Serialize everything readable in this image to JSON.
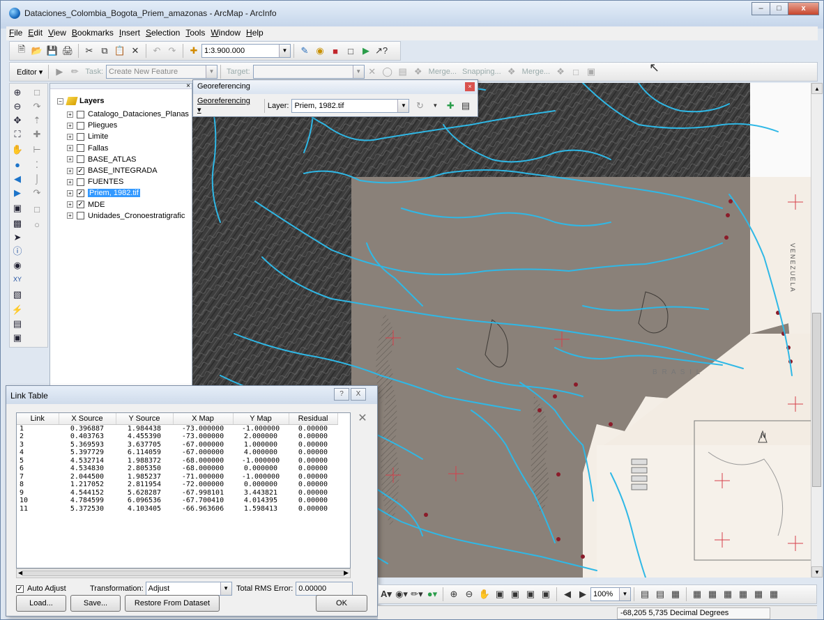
{
  "window": {
    "title": "Dataciones_Colombia_Bogota_Priem_amazonas - ArcMap - ArcInfo",
    "minimize": "–",
    "maximize": "□",
    "close": "x"
  },
  "menu": [
    "File",
    "Edit",
    "View",
    "Bookmarks",
    "Insert",
    "Selection",
    "Tools",
    "Window",
    "Help"
  ],
  "standard_toolbar": {
    "scale": "1:3.900.000"
  },
  "editor_toolbar": {
    "editor_label": "Editor ▾",
    "task_label": "Task:",
    "task_value": "Create New Feature",
    "target_label": "Target:",
    "target_value": "",
    "merge1": "Merge...",
    "snapping": "Snapping...",
    "merge2": "Merge..."
  },
  "toc": {
    "root_label": "Layers",
    "layers": [
      {
        "name": "Catalogo_Dataciones_Planas",
        "checked": false,
        "selected": false
      },
      {
        "name": "Pliegues",
        "checked": false,
        "selected": false
      },
      {
        "name": "Limite",
        "checked": false,
        "selected": false
      },
      {
        "name": "Fallas",
        "checked": false,
        "selected": false
      },
      {
        "name": "BASE_ATLAS",
        "checked": false,
        "selected": false
      },
      {
        "name": "BASE_INTEGRADA",
        "checked": true,
        "selected": false
      },
      {
        "name": "FUENTES",
        "checked": false,
        "selected": false
      },
      {
        "name": "Priem, 1982.tif",
        "checked": true,
        "selected": true
      },
      {
        "name": "MDE",
        "checked": true,
        "selected": false
      },
      {
        "name": "Unidades_Cronoestratigrafic",
        "checked": false,
        "selected": false
      }
    ]
  },
  "georef": {
    "title": "Georeferencing",
    "menu_label": "Georeferencing ▾",
    "layer_label": "Layer:",
    "layer_value": "Priem, 1982.tif"
  },
  "link_table": {
    "title": "Link Table",
    "help_btn": "?",
    "close_btn": "X",
    "columns": [
      "Link",
      "X Source",
      "Y Source",
      "X Map",
      "Y Map",
      "Residual"
    ],
    "rows": [
      [
        "1",
        "0.396887",
        "1.984438",
        "-73.000000",
        "-1.000000",
        "0.00000"
      ],
      [
        "2",
        "0.403763",
        "4.455390",
        "-73.000000",
        "2.000000",
        "0.00000"
      ],
      [
        "3",
        "5.369593",
        "3.637705",
        "-67.000000",
        "1.000000",
        "0.00000"
      ],
      [
        "4",
        "5.397729",
        "6.114059",
        "-67.000000",
        "4.000000",
        "0.00000"
      ],
      [
        "5",
        "4.532714",
        "1.988372",
        "-68.000000",
        "-1.000000",
        "0.00000"
      ],
      [
        "6",
        "4.534830",
        "2.805350",
        "-68.000000",
        "0.000000",
        "0.00000"
      ],
      [
        "7",
        "2.044500",
        "1.985237",
        "-71.000000",
        "-1.000000",
        "0.00000"
      ],
      [
        "8",
        "1.217052",
        "2.811954",
        "-72.000000",
        "0.000000",
        "0.00000"
      ],
      [
        "9",
        "4.544152",
        "5.628287",
        "-67.998101",
        "3.443821",
        "0.00000"
      ],
      [
        "10",
        "4.784599",
        "6.096536",
        "-67.700410",
        "4.014395",
        "0.00000"
      ],
      [
        "11",
        "5.372530",
        "4.103405",
        "-66.963606",
        "1.598413",
        "0.00000"
      ]
    ],
    "auto_adjust_label": "Auto Adjust",
    "auto_adjust_checked": true,
    "transformation_label": "Transformation:",
    "transformation_value": "Adjust",
    "rms_label": "Total RMS Error:",
    "rms_value": "0.00000",
    "load_btn": "Load...",
    "save_btn": "Save...",
    "restore_btn": "Restore From Dataset",
    "ok_btn": "OK"
  },
  "map": {
    "country_label_1": "VENEZUELA",
    "country_label_2": "B R A S I L",
    "north_label": "N"
  },
  "bottom_toolbar": {
    "zoom": "100%"
  },
  "status": {
    "coords": "-68,205  5,735 Decimal Degrees"
  },
  "colors": {
    "rivers": "#2fb8e6",
    "selection": "#3399ff",
    "hillshade": "#3b3b3b",
    "scan": "#8a8179"
  }
}
